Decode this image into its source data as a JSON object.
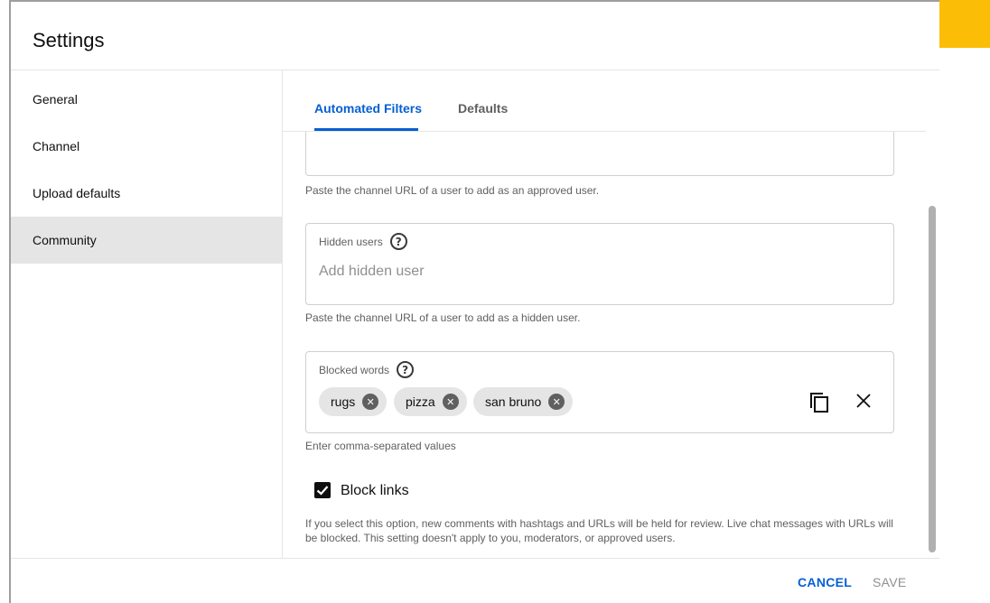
{
  "title": "Settings",
  "sidebar": {
    "items": [
      {
        "label": "General"
      },
      {
        "label": "Channel"
      },
      {
        "label": "Upload defaults"
      },
      {
        "label": "Community"
      }
    ],
    "active": "Community"
  },
  "tabs": [
    {
      "label": "Automated Filters"
    },
    {
      "label": "Defaults"
    }
  ],
  "approved_users": {
    "help": "Paste the channel URL of a user to add as an approved user."
  },
  "hidden_users": {
    "label": "Hidden users",
    "placeholder": "Add hidden user",
    "help": "Paste the channel URL of a user to add as a hidden user."
  },
  "blocked_words": {
    "label": "Blocked words",
    "chips": [
      "rugs",
      "pizza",
      "san bruno"
    ],
    "help": "Enter comma-separated values"
  },
  "block_links": {
    "label": "Block links",
    "checked": true,
    "description": "If you select this option, new comments with hashtags and URLs will be held for review. Live chat messages with URLs will be blocked. This setting doesn't apply to you, moderators, or approved users."
  },
  "footer": {
    "cancel": "CANCEL",
    "save": "SAVE"
  },
  "colors": {
    "accent": "#fbbd05",
    "primary": "#065fd4"
  }
}
